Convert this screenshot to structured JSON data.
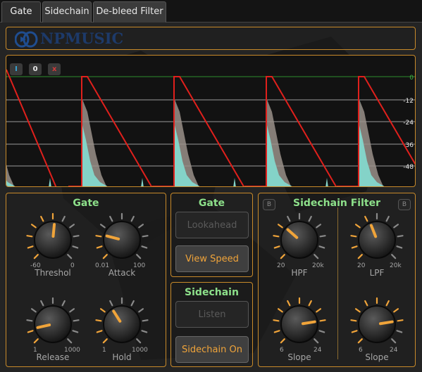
{
  "tabs": [
    {
      "label": "Gate",
      "active": true
    },
    {
      "label": "Sidechain",
      "active": false
    },
    {
      "label": "De-bleed Filter",
      "active": false
    }
  ],
  "logo": {
    "text": "NPMUSIC"
  },
  "scope": {
    "buttons": [
      {
        "label": "I",
        "color": "#39a7d6"
      },
      {
        "label": "0",
        "color": "#e8e8e8"
      },
      {
        "label": "x",
        "color": "#d23a3a"
      }
    ],
    "db_labels": [
      "0",
      "-12",
      "-24",
      "-36",
      "-48"
    ],
    "colors": {
      "gate_line": "#e0201c",
      "envelope": "#84d3c8",
      "signal": "#9a908a",
      "zero_line": "#2f8f2f"
    }
  },
  "gate": {
    "title": "Gate",
    "knobs": [
      {
        "label": "Threshol",
        "min": "-60",
        "max": "0"
      },
      {
        "label": "Attack",
        "min": "0.01",
        "max": "100"
      },
      {
        "label": "Release",
        "min": "1",
        "max": "1000"
      },
      {
        "label": "Hold",
        "min": "1",
        "max": "1000"
      }
    ]
  },
  "gate_buttons": {
    "title": "Gate",
    "lookahead": "Lookahead",
    "view_speed": "View Speed"
  },
  "sidechain": {
    "title": "Sidechain",
    "listen": "Listen",
    "sidechain_on": "Sidechain On"
  },
  "filter": {
    "title": "Sidechain Filter",
    "bypass_label": "B",
    "knobs": [
      {
        "label": "HPF",
        "min": "20",
        "max": "20k"
      },
      {
        "label": "LPF",
        "min": "20",
        "max": "20k"
      },
      {
        "label": "Slope",
        "min": "6",
        "max": "24"
      },
      {
        "label": "Slope",
        "min": "6",
        "max": "24"
      }
    ]
  },
  "accent_color": "#f0a43a"
}
